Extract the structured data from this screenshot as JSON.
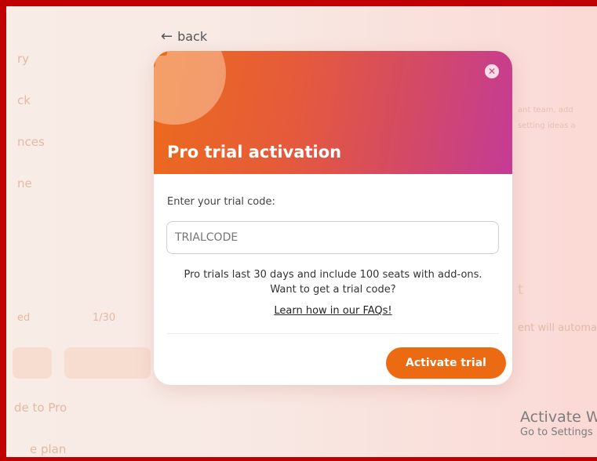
{
  "background": {
    "menu": [
      "ry",
      "ck",
      "nces",
      "ne"
    ],
    "stat_label": "ed",
    "stat_value": "1/30",
    "upgrade": "de to Pro",
    "plan": "e plan",
    "right_line1": "ant team, add",
    "right_line2": "setting ideas a",
    "right_title": "t",
    "right_line3": "ent will automat"
  },
  "back_link": {
    "icon": "arrow-left-icon",
    "label": "back"
  },
  "modal": {
    "title": "Pro trial activation",
    "close_icon": "close-icon",
    "input_label": "Enter your trial code:",
    "input_placeholder": "TRIALCODE",
    "info_line1": "Pro trials last 30 days and include 100 seats with add-ons.",
    "info_line2": "Want to get a trial code?",
    "faq_link": "Learn how in our FAQs!",
    "activate_button": "Activate trial"
  },
  "watermark": {
    "line1": "Activate W",
    "line2": "Go to Settings"
  },
  "colors": {
    "frame": "#c00000",
    "accent": "#ec6b12",
    "header_start": "#ec6b1b",
    "header_end": "#c43b96"
  }
}
